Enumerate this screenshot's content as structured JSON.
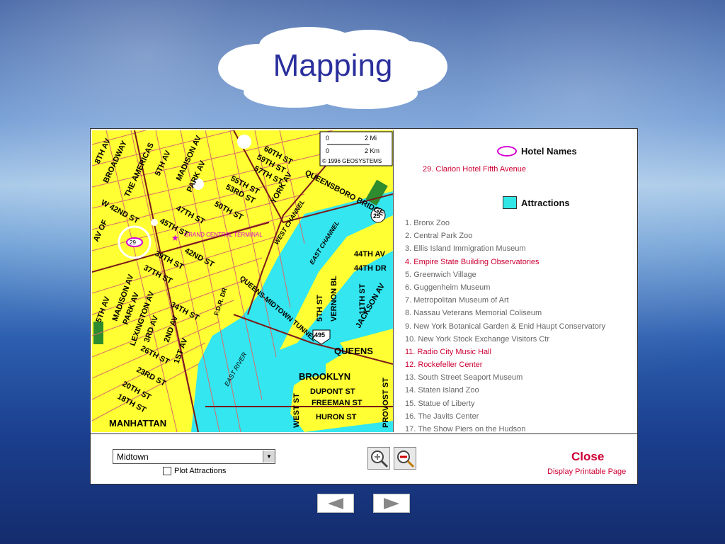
{
  "slide": {
    "title": "Mapping"
  },
  "map": {
    "scale": {
      "mi_zero": "0",
      "mi_two": "2 Mi",
      "km_zero": "0",
      "km_two": "2 Km",
      "copyright": "© 1996 GEOSYSTEMS"
    },
    "labels": [
      "8TH AV",
      "BROADWAY",
      "THE AMERICAS",
      "5TH AV",
      "MADISON AV",
      "PARK AV",
      "60TH ST",
      "59TH ST",
      "57TH ST",
      "55TH ST",
      "53RD ST",
      "50TH ST",
      "47TH ST",
      "45TH ST",
      "42ND ST",
      "W 42ND ST",
      "AV OF",
      "39TH ST",
      "37TH ST",
      "34TH ST",
      "QUEENSBORO BRIDGE",
      "YORK AV",
      "WEST CHANNEL",
      "EAST CHANNEL",
      "GRAND CENTRAL TERMINAL",
      "5TH AV",
      "MADISON AV",
      "PARK AV",
      "LEXINGTON AV",
      "3RD AV",
      "2ND AV",
      "1ST AV",
      "26TH ST",
      "23RD ST",
      "20TH ST",
      "18TH ST",
      "F.D.R. DR",
      "QUEENS-MIDTOWN TUNNEL",
      "EAST RIVER",
      "5TH ST",
      "VERNON BL",
      "11TH ST",
      "JACKSON AV",
      "44TH AV",
      "44TH DR",
      "QUEENS",
      "BROOKLYN",
      "DUPONT ST",
      "FREEMAN ST",
      "HURON ST",
      "WEST ST",
      "PROVOST ST",
      "MANHATTAN"
    ],
    "hotel_marker": "29",
    "shield_25": "25",
    "shield_495": "495"
  },
  "legend": {
    "hotel_header": "Hotel Names",
    "hotel_item": "29. Clarion Hotel Fifth Avenue",
    "attractions_header": "Attractions",
    "attractions": [
      "1. Bronx Zoo",
      "2. Central Park Zoo",
      "3. Ellis Island Immigration Museum",
      "4. Empire State Building Observatories",
      "5. Greenwich Village",
      "6. Guggenheim Museum",
      "7. Metropolitan Museum of Art",
      "8. Nassau Veterans Memorial Coliseum",
      "9. New York Botanical Garden & Enid Haupt Conservatory",
      "10. New York Stock Exchange Visitors Ctr",
      "11. Radio City Music Hall",
      "12. Rockefeller Center",
      "13. South Street Seaport Museum",
      "14. Staten Island Zoo",
      "15. Statue of Liberty",
      "16. The Javits Center",
      "17. The Show Piers on the Hudson"
    ],
    "highlighted": [
      3,
      10,
      11
    ],
    "colors": {
      "highlight": "#cc0033",
      "normal": "#666666",
      "attraction": "#33e6e6",
      "hotel": "#d400d4"
    }
  },
  "controls": {
    "area_select": "Midtown",
    "plot_attractions": "Plot Attractions",
    "close": "Close",
    "print": "Display Printable Page"
  },
  "nav": {
    "prev": "previous-slide",
    "next": "next-slide"
  }
}
